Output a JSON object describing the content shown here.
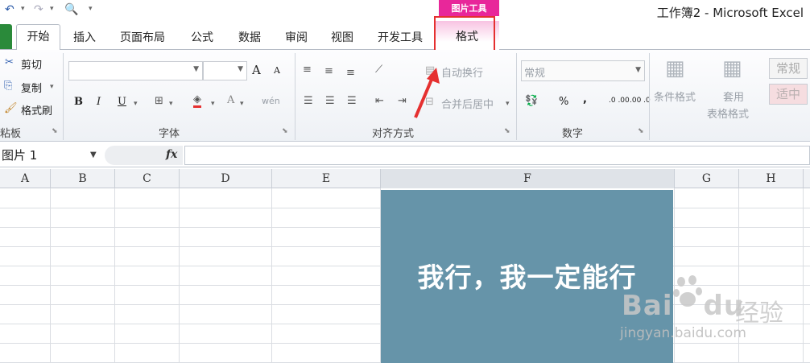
{
  "quick_access": {
    "undo_icon": "undo-icon",
    "redo_icon": "redo-icon",
    "print_preview_icon": "print-preview-icon"
  },
  "title_bar": {
    "context_tab_group": "图片工具",
    "app_title": "工作簿2 - Microsoft Excel"
  },
  "tabs": [
    {
      "label": "开始"
    },
    {
      "label": "插入"
    },
    {
      "label": "页面布局"
    },
    {
      "label": "公式"
    },
    {
      "label": "数据"
    },
    {
      "label": "审阅"
    },
    {
      "label": "视图"
    },
    {
      "label": "开发工具"
    },
    {
      "label": "格式"
    }
  ],
  "ribbon": {
    "clipboard": {
      "cut": "剪切",
      "copy": "复制",
      "format_painter": "格式刷",
      "label": "粘板"
    },
    "font": {
      "bold": "B",
      "italic": "I",
      "underline": "U",
      "font_size_up": "A",
      "font_size_down": "A",
      "font_color": "A",
      "phonetic": "wén",
      "label": "字体"
    },
    "alignment": {
      "wrap_text": "自动换行",
      "merge_center": "合并后居中",
      "label": "对齐方式"
    },
    "number": {
      "format_value": "常规",
      "percent": "%",
      "comma": ",",
      "inc_decimal": ".0 .00",
      "dec_decimal": ".00 .0",
      "label": "数字"
    },
    "styles": {
      "conditional_format": "条件格式",
      "apply_table": "套用",
      "table_format": "表格格式",
      "style_normal": "常规",
      "style_neutral": "适中"
    }
  },
  "formula_bar": {
    "name_box": "图片 1",
    "fx": "fx",
    "formula": ""
  },
  "columns": [
    "A",
    "B",
    "C",
    "D",
    "E",
    "F",
    "G",
    "H"
  ],
  "picture": {
    "text": "我行，我一定能行",
    "background": "#6694a9"
  },
  "watermark": {
    "brand": "Bai",
    "brand_suffix": "du",
    "jingyan": "经验",
    "url": "jingyan.baidu.com"
  },
  "colors": {
    "context_tab": "#e8279a",
    "highlight": "#e53030",
    "file_tab": "#2a8a3a"
  }
}
